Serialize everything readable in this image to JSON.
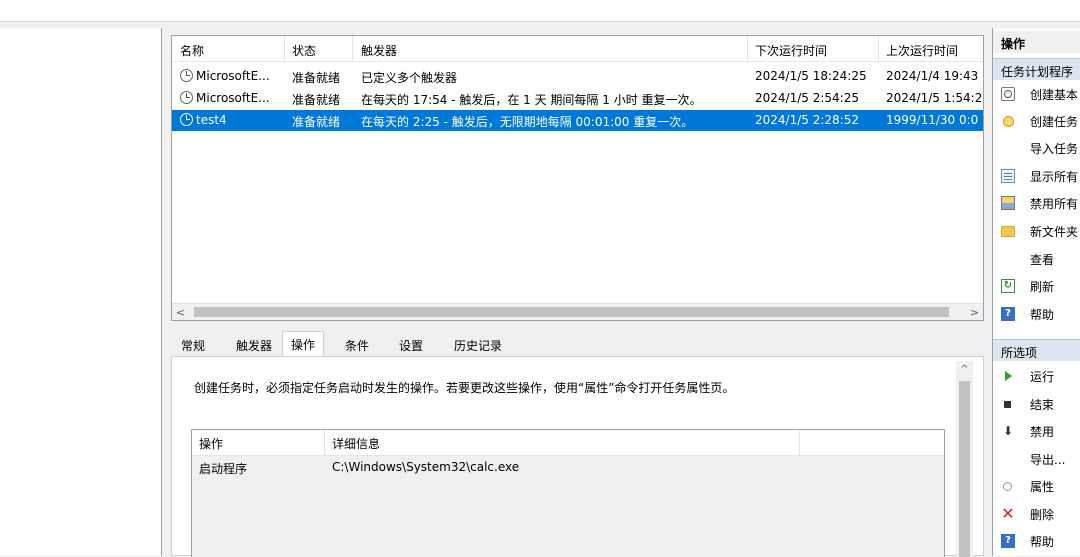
{
  "task_list": {
    "columns": [
      "名称",
      "状态",
      "触发器",
      "下次运行时间",
      "上次运行时间"
    ],
    "rows": [
      {
        "name": "MicrosoftE...",
        "status": "准备就绪",
        "trigger": "已定义多个触发器",
        "next_run": "2024/1/5 18:24:25",
        "last_run": "2024/1/4 19:43",
        "selected": false
      },
      {
        "name": "MicrosoftE...",
        "status": "准备就绪",
        "trigger": "在每天的 17:54 - 触发后，在 1 天 期间每隔 1 小时 重复一次。",
        "next_run": "2024/1/5 2:54:25",
        "last_run": "2024/1/5 1:54:2",
        "selected": false
      },
      {
        "name": "test4",
        "status": "准备就绪",
        "trigger": "在每天的 2:25 - 触发后，无限期地每隔 00:01:00 重复一次。",
        "next_run": "2024/1/5 2:28:52",
        "last_run": "1999/11/30 0:0",
        "selected": true
      }
    ],
    "scroll_left_arrow": "<",
    "scroll_right_arrow": ">"
  },
  "detail_tabs": [
    "常规",
    "触发器",
    "操作",
    "条件",
    "设置",
    "历史记录"
  ],
  "active_tab": "操作",
  "detail": {
    "description": "创建任务时，必须指定任务启动时发生的操作。若要更改这些操作，使用“属性”命令打开任务属性页。",
    "columns": [
      "操作",
      "详细信息"
    ],
    "rows": [
      {
        "action": "启动程序",
        "details": "C:\\Windows\\System32\\calc.exe"
      }
    ],
    "scroll_up_arrow": "^"
  },
  "actions_pane": {
    "title": "操作",
    "section1": {
      "header": "任务计划程序",
      "items": [
        {
          "label": "创建基本",
          "icon": "calendar-icon"
        },
        {
          "label": "创建任务",
          "icon": "clock-icon"
        },
        {
          "label": "导入任务",
          "icon": ""
        },
        {
          "label": "显示所有",
          "icon": "list-icon"
        },
        {
          "label": "禁用所有",
          "icon": "disable-all-icon"
        },
        {
          "label": "新文件夹",
          "icon": "folder-icon"
        },
        {
          "label": "查看",
          "icon": ""
        },
        {
          "label": "刷新",
          "icon": "refresh-icon"
        },
        {
          "label": "帮助",
          "icon": "help-icon"
        }
      ]
    },
    "section2": {
      "header": "所选项",
      "items": [
        {
          "label": "运行",
          "icon": "run-icon"
        },
        {
          "label": "结束",
          "icon": "end-icon"
        },
        {
          "label": "禁用",
          "icon": "disable-icon"
        },
        {
          "label": "导出...",
          "icon": ""
        },
        {
          "label": "属性",
          "icon": "properties-icon"
        },
        {
          "label": "删除",
          "icon": "delete-icon"
        },
        {
          "label": "帮助",
          "icon": "help-icon"
        }
      ]
    },
    "glyphs": {
      "refresh": "↻",
      "help": "?",
      "disable": "⬇",
      "delete": "✕"
    }
  },
  "colors": {
    "selection": "#0078d7",
    "section_header": "#dde6f0"
  }
}
